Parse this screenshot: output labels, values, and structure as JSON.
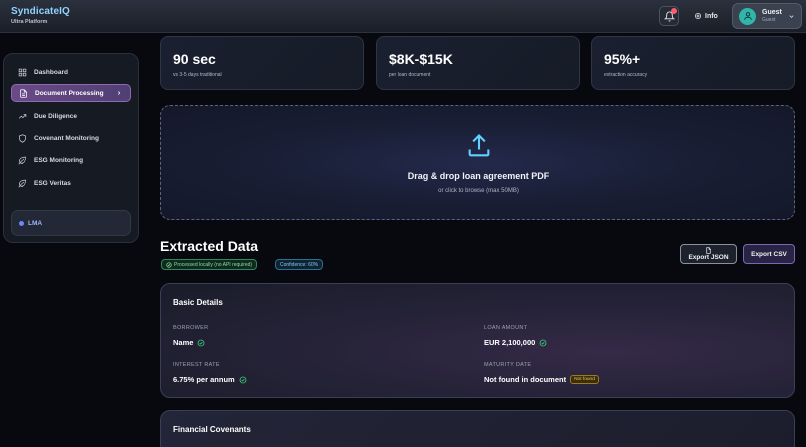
{
  "brand": {
    "title": "SyndicateIQ",
    "subtitle": "Ultra Platform"
  },
  "header": {
    "info_label": "Info",
    "user_name": "Guest",
    "user_role": "Guest"
  },
  "sidebar": {
    "items": [
      {
        "label": "Dashboard",
        "icon": "grid-icon"
      },
      {
        "label": "Document Processing",
        "icon": "document-icon",
        "active": true
      },
      {
        "label": "Due Diligence",
        "icon": "trend-icon"
      },
      {
        "label": "Covenant Monitoring",
        "icon": "shield-icon"
      },
      {
        "label": "ESG Monitoring",
        "icon": "leaf-icon"
      },
      {
        "label": "ESG Veritas",
        "icon": "leaf-icon"
      }
    ],
    "footer_label": "LMA"
  },
  "stats": [
    {
      "value": "90 sec",
      "label": "vs 3-5 days traditional"
    },
    {
      "value": "$8K-$15K",
      "label": "per loan document"
    },
    {
      "value": "95%+",
      "label": "extraction accuracy"
    }
  ],
  "upload": {
    "title": "Drag & drop loan agreement PDF",
    "subtitle": "or click to browse (max 50MB)"
  },
  "extracted": {
    "title": "Extracted Data",
    "badge_local": "Processed locally (no API required)",
    "badge_confidence": "Confidence: 60%",
    "export_json": "Export JSON",
    "export_csv": "Export CSV"
  },
  "basic_details": {
    "title": "Basic Details",
    "borrower_label": "BORROWER",
    "borrower_value": "Name",
    "loan_amount_label": "LOAN AMOUNT",
    "loan_amount_value": "EUR 2,100,000",
    "interest_rate_label": "INTEREST RATE",
    "interest_rate_value": "6.75% per annum",
    "maturity_label": "MATURITY DATE",
    "maturity_value": "Not found in document",
    "maturity_badge": "Not found"
  },
  "financial_covenants": {
    "title": "Financial Covenants"
  },
  "colors": {
    "accent": "#8fd3ff",
    "active_nav": "#6b4a87",
    "success": "#37c97a",
    "warning": "#f0c64b"
  }
}
